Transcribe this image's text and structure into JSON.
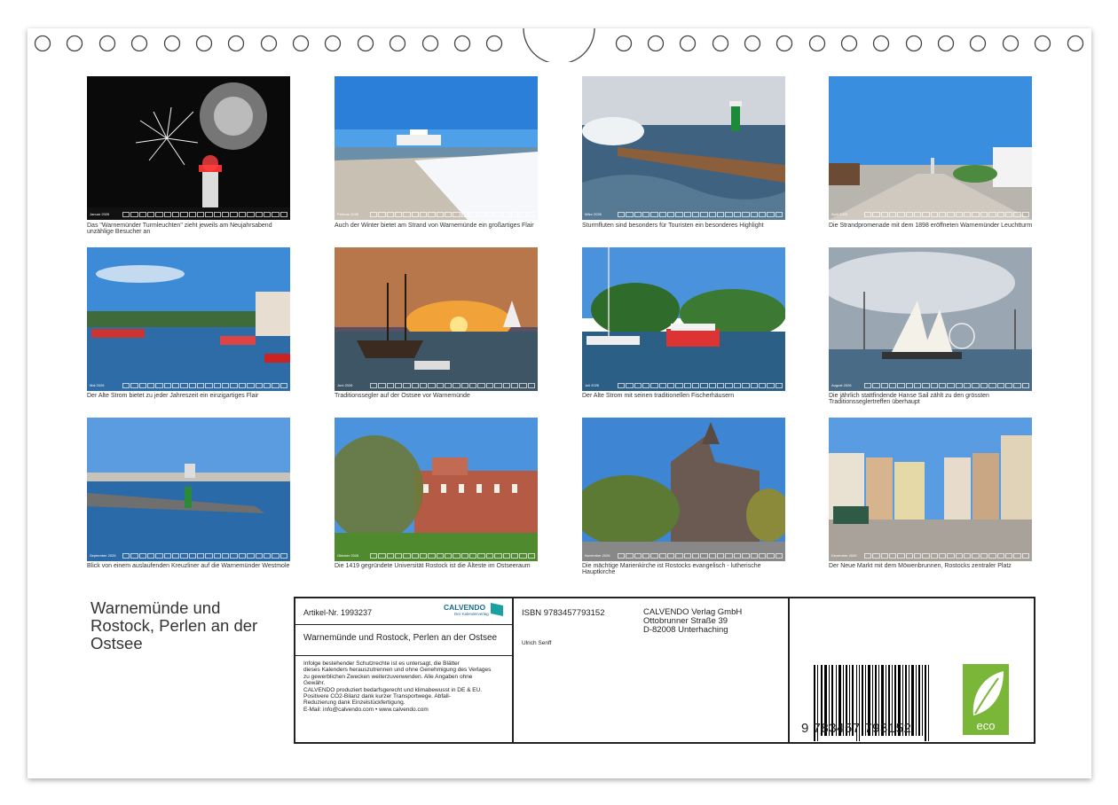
{
  "calendar": {
    "title": "Warnemünde und Rostock, Perlen an der Ostsee",
    "months": [
      {
        "strip": "Januar 2026",
        "caption": "Das \"Warnemünder Turmleuchten\" zieht jeweils am Neujahrsabend unzählige Besucher an"
      },
      {
        "strip": "Februar 2026",
        "caption": "Auch der Winter bietet am Strand von Warnemünde ein großartiges Flair"
      },
      {
        "strip": "März 2026",
        "caption": "Sturmfluten sind besonders für Touristen ein besonderes Highlight"
      },
      {
        "strip": "April 2026",
        "caption": "Die Strandpromenade mit dem 1898 eröffneten Warnemünder Leuchtturm"
      },
      {
        "strip": "Mai 2026",
        "caption": "Der Alte Strom bietet zu jeder Jahreszeit ein einzigartiges Flair"
      },
      {
        "strip": "Juni 2026",
        "caption": "Traditionssegler auf der Ostsee vor Warnemünde"
      },
      {
        "strip": "Juli 2026",
        "caption": "Der Alte Strom mit seinen traditionellen Fischerhäusern"
      },
      {
        "strip": "August 2026",
        "caption": "Die jährlich stattfindende Hanse Sail zählt zu den grössten Traditionsseglertreffen überhaupt"
      },
      {
        "strip": "September 2026",
        "caption": "Blick von einem auslaufenden Kreuzliner auf die Warnemünder Westmole"
      },
      {
        "strip": "Oktober 2026",
        "caption": "Die 1419 gegründete Universität Rostock ist die Älteste im Ostseeraum"
      },
      {
        "strip": "November 2026",
        "caption": "Die mächtige Marienkirche ist Rostocks evangelisch - lutherische Hauptkirche"
      },
      {
        "strip": "Dezember 2026",
        "caption": "Der Neue Markt mit dem Möwenbrunnen, Rostocks zentraler Platz"
      }
    ]
  },
  "info": {
    "article": "Artikel-Nr. 1993237",
    "brand": "CALVENDO",
    "brand_sub": "Der Kalenderverlag",
    "title": "Warnemünde und Rostock, Perlen an der Ostsee",
    "legal": [
      "Infolge bestehender Schutzrechte ist es untersagt, die Blätter",
      "dieses Kalenders herauszutrennen und ohne Genehmigung des Verlages",
      "zu gewerblichen Zwecken weiterzuverwenden. Alle Angaben ohne",
      "Gewähr.",
      "CALVENDO produziert bedarfsgerecht und klimabewusst in DE & EU.",
      "Positivere CO2-Bilanz dank kurzer Transportwege. Abfall-",
      "Reduzierung dank Einzelstückfertigung.",
      "E-Mail: info@calvendo.com • www.calvendo.com"
    ],
    "isbn": "ISBN 9783457793152",
    "author": "Ulrich Senff",
    "publisher": [
      "CALVENDO Verlag GmbH",
      "Ottobrunner Straße 39",
      "D-82008 Unterhaching"
    ],
    "barcode_digits": "9  783457  793152",
    "eco_label": "eco"
  }
}
